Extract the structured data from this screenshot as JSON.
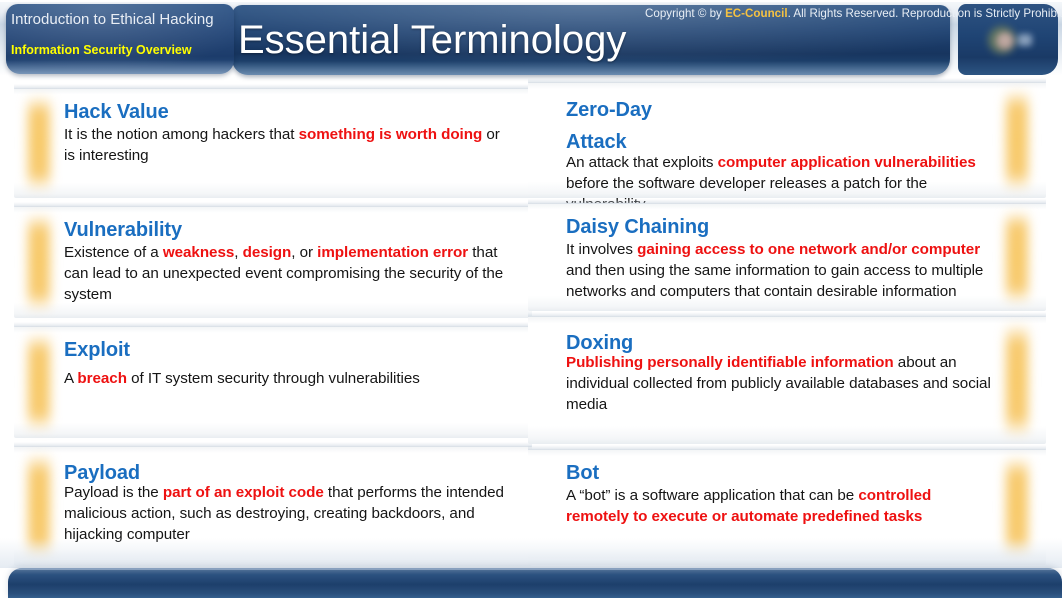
{
  "header": {
    "tab_line1": "Introduction to Ethical Hacking",
    "tab_line2": "Information Security Overview",
    "title": "Essential Terminology",
    "logo_name": "ec-council-logo"
  },
  "colors": {
    "title_blue": "#1a6ec0",
    "highlight_red": "#ee1111",
    "accent_orange": "#f6c156",
    "header_navy": "#1f4373",
    "tab_yellow": "#ffff00",
    "footer_gold": "#f5c242"
  },
  "left_column": [
    {
      "id": "hack-value",
      "title": "Hack Value",
      "body_segments": [
        {
          "text": "It is the notion among hackers that ",
          "highlight": false
        },
        {
          "text": "something is worth doing",
          "highlight": true
        },
        {
          "text": " or is interesting",
          "highlight": false
        }
      ],
      "body_plain": "It is the notion among hackers that something is worth doing or is interesting"
    },
    {
      "id": "vulnerability",
      "title": "Vulnerability",
      "body_segments": [
        {
          "text": "Existence of a ",
          "highlight": false
        },
        {
          "text": "weakness",
          "highlight": true
        },
        {
          "text": ", ",
          "highlight": false
        },
        {
          "text": "design",
          "highlight": true
        },
        {
          "text": ", or ",
          "highlight": false
        },
        {
          "text": "implementation error",
          "highlight": true
        },
        {
          "text": " that can lead to an unexpected event compromising the security of the system",
          "highlight": false
        }
      ],
      "body_plain": "Existence of a weakness, design, or implementation error that can lead to an unexpected event compromising the security of the system"
    },
    {
      "id": "exploit",
      "title": "Exploit",
      "body_segments": [
        {
          "text": "A ",
          "highlight": false
        },
        {
          "text": "breach",
          "highlight": true
        },
        {
          "text": " of IT system security through vulnerabilities",
          "highlight": false
        }
      ],
      "body_plain": "A breach of IT system security through vulnerabilities"
    },
    {
      "id": "payload",
      "title": "Payload",
      "body_segments": [
        {
          "text": "Payload  is the ",
          "highlight": false
        },
        {
          "text": "part of an exploit code",
          "highlight": true
        },
        {
          "text": " that performs the intended malicious action, such as destroying, creating backdoors, and hijacking computer",
          "highlight": false
        }
      ],
      "body_plain": "Payload  is the part of an exploit code that performs the intended malicious action, such as destroying, creating backdoors, and hijacking computer"
    }
  ],
  "right_column": [
    {
      "id": "zero-day-attack",
      "title": "Zero-Day Attack",
      "body_segments": [
        {
          "text": "An attack that exploits ",
          "highlight": false
        },
        {
          "text": "computer application vulnerabilities",
          "highlight": true
        },
        {
          "text": " before the software developer releases a patch for the vulnerability",
          "highlight": false
        }
      ],
      "body_plain": "An attack that exploits computer application vulnerabilities before the software developer releases a patch for the vulnerability"
    },
    {
      "id": "daisy-chaining",
      "title": "Daisy Chaining",
      "body_segments": [
        {
          "text": "It involves ",
          "highlight": false
        },
        {
          "text": "gaining access to one network and/or computer",
          "highlight": true
        },
        {
          "text": " and then using the same information to gain access to multiple networks and computers that contain desirable information",
          "highlight": false
        }
      ],
      "body_plain": "It involves gaining access to one network and/or computer and then using the same information to gain access to multiple networks and computers that contain desirable information"
    },
    {
      "id": "doxing",
      "title": "Doxing",
      "body_segments": [
        {
          "text": "Publishing personally identifiable information",
          "highlight": true
        },
        {
          "text": " about an individual collected from publicly available databases and social media",
          "highlight": false
        }
      ],
      "body_plain": "Publishing personally identifiable information about an individual collected from publicly available databases and social media"
    },
    {
      "id": "bot",
      "title": "Bot",
      "body_segments": [
        {
          "text": "A “bot” is a software application that can be ",
          "highlight": false
        },
        {
          "text": "controlled remotely to execute or automate predefined tasks",
          "highlight": true
        }
      ],
      "body_plain": "A “bot” is a software application that can be controlled remotely to execute or automate predefined tasks"
    }
  ],
  "footer": {
    "prefix": "Copyright © by ",
    "brand": "EC-Council",
    "suffix": ". All Rights Reserved. Reproduction is Strictly Prohibite"
  }
}
